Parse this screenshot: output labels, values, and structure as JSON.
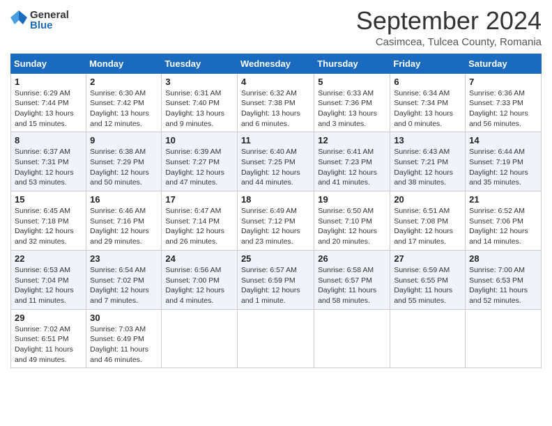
{
  "logo": {
    "general": "General",
    "blue": "Blue"
  },
  "title": "September 2024",
  "location": "Casimcea, Tulcea County, Romania",
  "days_of_week": [
    "Sunday",
    "Monday",
    "Tuesday",
    "Wednesday",
    "Thursday",
    "Friday",
    "Saturday"
  ],
  "weeks": [
    [
      {
        "day": "1",
        "sunrise": "6:29 AM",
        "sunset": "7:44 PM",
        "daylight": "13 hours and 15 minutes."
      },
      {
        "day": "2",
        "sunrise": "6:30 AM",
        "sunset": "7:42 PM",
        "daylight": "13 hours and 12 minutes."
      },
      {
        "day": "3",
        "sunrise": "6:31 AM",
        "sunset": "7:40 PM",
        "daylight": "13 hours and 9 minutes."
      },
      {
        "day": "4",
        "sunrise": "6:32 AM",
        "sunset": "7:38 PM",
        "daylight": "13 hours and 6 minutes."
      },
      {
        "day": "5",
        "sunrise": "6:33 AM",
        "sunset": "7:36 PM",
        "daylight": "13 hours and 3 minutes."
      },
      {
        "day": "6",
        "sunrise": "6:34 AM",
        "sunset": "7:34 PM",
        "daylight": "13 hours and 0 minutes."
      },
      {
        "day": "7",
        "sunrise": "6:36 AM",
        "sunset": "7:33 PM",
        "daylight": "12 hours and 56 minutes."
      }
    ],
    [
      {
        "day": "8",
        "sunrise": "6:37 AM",
        "sunset": "7:31 PM",
        "daylight": "12 hours and 53 minutes."
      },
      {
        "day": "9",
        "sunrise": "6:38 AM",
        "sunset": "7:29 PM",
        "daylight": "12 hours and 50 minutes."
      },
      {
        "day": "10",
        "sunrise": "6:39 AM",
        "sunset": "7:27 PM",
        "daylight": "12 hours and 47 minutes."
      },
      {
        "day": "11",
        "sunrise": "6:40 AM",
        "sunset": "7:25 PM",
        "daylight": "12 hours and 44 minutes."
      },
      {
        "day": "12",
        "sunrise": "6:41 AM",
        "sunset": "7:23 PM",
        "daylight": "12 hours and 41 minutes."
      },
      {
        "day": "13",
        "sunrise": "6:43 AM",
        "sunset": "7:21 PM",
        "daylight": "12 hours and 38 minutes."
      },
      {
        "day": "14",
        "sunrise": "6:44 AM",
        "sunset": "7:19 PM",
        "daylight": "12 hours and 35 minutes."
      }
    ],
    [
      {
        "day": "15",
        "sunrise": "6:45 AM",
        "sunset": "7:18 PM",
        "daylight": "12 hours and 32 minutes."
      },
      {
        "day": "16",
        "sunrise": "6:46 AM",
        "sunset": "7:16 PM",
        "daylight": "12 hours and 29 minutes."
      },
      {
        "day": "17",
        "sunrise": "6:47 AM",
        "sunset": "7:14 PM",
        "daylight": "12 hours and 26 minutes."
      },
      {
        "day": "18",
        "sunrise": "6:49 AM",
        "sunset": "7:12 PM",
        "daylight": "12 hours and 23 minutes."
      },
      {
        "day": "19",
        "sunrise": "6:50 AM",
        "sunset": "7:10 PM",
        "daylight": "12 hours and 20 minutes."
      },
      {
        "day": "20",
        "sunrise": "6:51 AM",
        "sunset": "7:08 PM",
        "daylight": "12 hours and 17 minutes."
      },
      {
        "day": "21",
        "sunrise": "6:52 AM",
        "sunset": "7:06 PM",
        "daylight": "12 hours and 14 minutes."
      }
    ],
    [
      {
        "day": "22",
        "sunrise": "6:53 AM",
        "sunset": "7:04 PM",
        "daylight": "12 hours and 11 minutes."
      },
      {
        "day": "23",
        "sunrise": "6:54 AM",
        "sunset": "7:02 PM",
        "daylight": "12 hours and 7 minutes."
      },
      {
        "day": "24",
        "sunrise": "6:56 AM",
        "sunset": "7:00 PM",
        "daylight": "12 hours and 4 minutes."
      },
      {
        "day": "25",
        "sunrise": "6:57 AM",
        "sunset": "6:59 PM",
        "daylight": "12 hours and 1 minute."
      },
      {
        "day": "26",
        "sunrise": "6:58 AM",
        "sunset": "6:57 PM",
        "daylight": "11 hours and 58 minutes."
      },
      {
        "day": "27",
        "sunrise": "6:59 AM",
        "sunset": "6:55 PM",
        "daylight": "11 hours and 55 minutes."
      },
      {
        "day": "28",
        "sunrise": "7:00 AM",
        "sunset": "6:53 PM",
        "daylight": "11 hours and 52 minutes."
      }
    ],
    [
      {
        "day": "29",
        "sunrise": "7:02 AM",
        "sunset": "6:51 PM",
        "daylight": "11 hours and 49 minutes."
      },
      {
        "day": "30",
        "sunrise": "7:03 AM",
        "sunset": "6:49 PM",
        "daylight": "11 hours and 46 minutes."
      },
      null,
      null,
      null,
      null,
      null
    ]
  ]
}
